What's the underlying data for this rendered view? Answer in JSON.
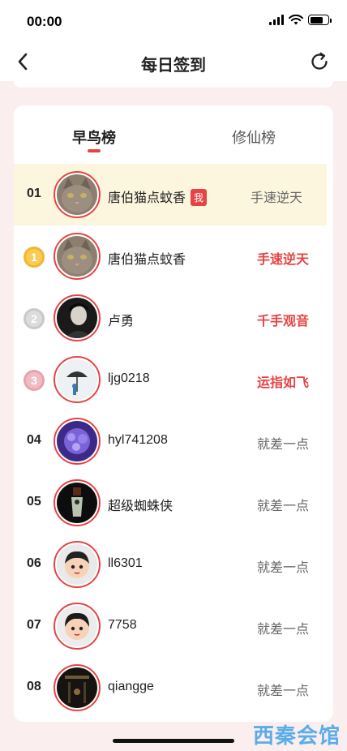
{
  "status": {
    "time": "00:00"
  },
  "header": {
    "title": "每日签到"
  },
  "tabs": [
    {
      "label": "早鸟榜",
      "active": true
    },
    {
      "label": "修仙榜",
      "active": false
    }
  ],
  "my_row": {
    "rank": "01",
    "name": "唐伯猫点蚊香",
    "badge": "我",
    "title": "手速逆天"
  },
  "rows": [
    {
      "rank": "1",
      "name": "唐伯猫点蚊香",
      "title": "手速逆天"
    },
    {
      "rank": "2",
      "name": "卢勇",
      "title": "千手观音"
    },
    {
      "rank": "3",
      "name": "ljg0218",
      "title": "运指如飞"
    },
    {
      "rank": "04",
      "name": "hyl741208",
      "title": "就差一点"
    },
    {
      "rank": "05",
      "name": "超级蜘蛛侠",
      "title": "就差一点"
    },
    {
      "rank": "06",
      "name": "ll6301",
      "title": "就差一点"
    },
    {
      "rank": "07",
      "name": "7758",
      "title": "就差一点"
    },
    {
      "rank": "08",
      "name": "qiangge",
      "title": "就差一点"
    }
  ],
  "watermark": "西秦会馆",
  "colors": {
    "accent": "#e64444",
    "highlight": "#fdf6df",
    "page_bg": "#fbeeee"
  }
}
